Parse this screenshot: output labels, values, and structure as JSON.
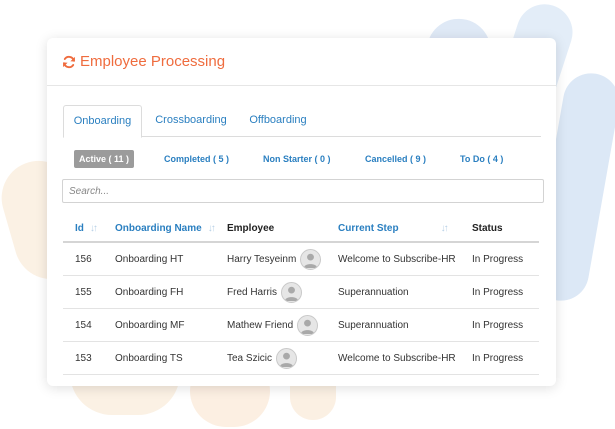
{
  "header": {
    "title": "Employee Processing",
    "icon": "refresh-icon",
    "accent": "#ef6c3e"
  },
  "tabs": [
    {
      "label": "Onboarding",
      "active": true
    },
    {
      "label": "Crossboarding",
      "active": false
    },
    {
      "label": "Offboarding",
      "active": false
    }
  ],
  "filters": [
    {
      "label": "Active ( 11 )",
      "active": true
    },
    {
      "label": "Completed ( 5 )",
      "active": false
    },
    {
      "label": "Non Starter ( 0 )",
      "active": false
    },
    {
      "label": "Cancelled ( 9 )",
      "active": false
    },
    {
      "label": "To Do ( 4 )",
      "active": false
    }
  ],
  "search": {
    "placeholder": "Search..."
  },
  "table": {
    "columns": [
      {
        "label": "Id",
        "sortable": true
      },
      {
        "label": "Onboarding Name",
        "sortable": true
      },
      {
        "label": "Employee",
        "sortable": false
      },
      {
        "label": "Current Step",
        "sortable": true
      },
      {
        "label": "Status",
        "sortable": false
      }
    ],
    "rows": [
      {
        "id": "156",
        "name": "Onboarding HT",
        "employee": "Harry Tesyeinm",
        "step": "Welcome to Subscribe-HR",
        "status": "In Progress"
      },
      {
        "id": "155",
        "name": "Onboarding FH",
        "employee": "Fred Harris",
        "step": "Superannuation",
        "status": "In Progress"
      },
      {
        "id": "154",
        "name": "Onboarding MF",
        "employee": "Mathew Friend",
        "step": "Superannuation",
        "status": "In Progress"
      },
      {
        "id": "153",
        "name": "Onboarding TS",
        "employee": "Tea Szicic",
        "step": "Welcome to Subscribe-HR",
        "status": "In Progress"
      }
    ]
  },
  "colors": {
    "link": "#2a7fc0",
    "status": "#f0a13a",
    "filter_active_bg": "#9b9b9b"
  }
}
